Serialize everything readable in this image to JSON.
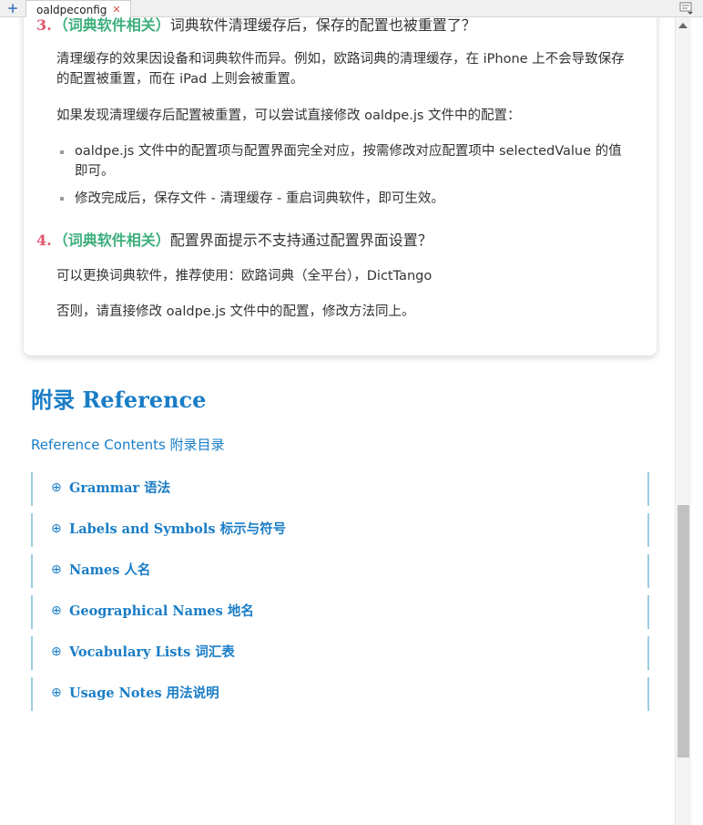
{
  "tabs": {
    "add_icon": "plus-icon",
    "active_tab": {
      "label": "oaldpeconfig",
      "close_icon": "close-icon"
    },
    "menu_icon": "tab-list-icon"
  },
  "faq": {
    "q3": {
      "number": "3.",
      "tag": "（词典软件相关）",
      "title": "词典软件清理缓存后，保存的配置也被重置了？",
      "para1": "清理缓存的效果因设备和词典软件而异。例如，欧路词典的清理缓存，在 iPhone 上不会导致保存的配置被重置，而在 iPad 上则会被重置。",
      "para2": "如果发现清理缓存后配置被重置，可以尝试直接修改 oaldpe.js 文件中的配置：",
      "bullets": [
        "oaldpe.js 文件中的配置项与配置界面完全对应，按需修改对应配置项中 selectedValue 的值即可。",
        "修改完成后，保存文件 - 清理缓存 - 重启词典软件，即可生效。"
      ]
    },
    "q4": {
      "number": "4.",
      "tag": "（词典软件相关）",
      "title": "配置界面提示不支持通过配置界面设置？",
      "para1": "可以更换词典软件，推荐使用：欧路词典（全平台），DictTango",
      "para2": "否则，请直接修改 oaldpe.js 文件中的配置，修改方法同上。"
    }
  },
  "reference": {
    "title": "附录 Reference",
    "contents_link": "Reference Contents 附录目录",
    "expand_symbol": "⊕",
    "items": [
      {
        "label": "Grammar  语法"
      },
      {
        "label": "Labels  and  Symbols  标示与符号"
      },
      {
        "label": "Names  人名"
      },
      {
        "label": "Geographical  Names  地名"
      },
      {
        "label": "Vocabulary  Lists  词汇表"
      },
      {
        "label": "Usage  Notes  用法说明"
      }
    ]
  },
  "colors": {
    "accent_blue": "#1a7dc6",
    "number_red": "#e0566c",
    "tag_green": "#3eaf7c"
  }
}
